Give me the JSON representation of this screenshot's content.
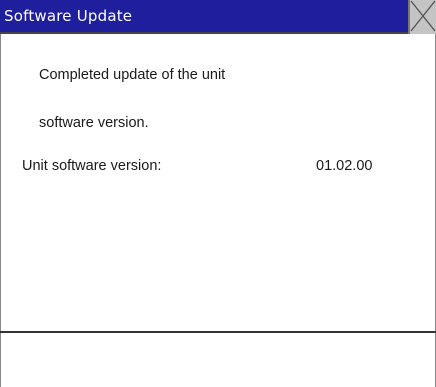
{
  "window": {
    "title": "Software Update",
    "title_bar_color": "#1f1f9e",
    "close_icon": "close-x-icon"
  },
  "message": {
    "line1": "Completed update of the unit",
    "line2": "software version."
  },
  "version": {
    "label": "Unit software version:",
    "value": "01.02.00"
  }
}
